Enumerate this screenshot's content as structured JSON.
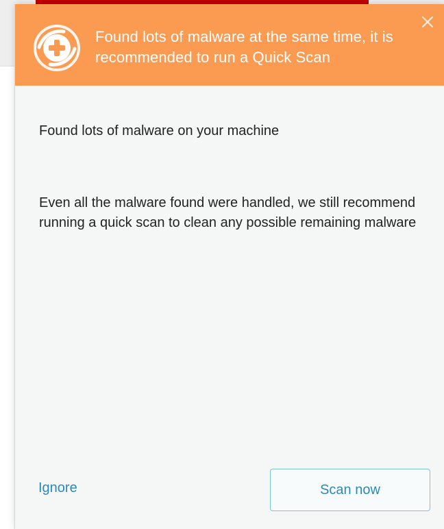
{
  "notification": {
    "title": "Found lots of malware at the same time, it is recommended to run a Quick Scan",
    "heading": "Found lots of malware on your machine",
    "body": "Even all the malware found were handled, we still recommend running a quick scan to clean any possible remaining malware",
    "actions": {
      "ignore_label": "Ignore",
      "scan_label": "Scan now"
    }
  },
  "colors": {
    "header_background": "#fb9b52",
    "link_blue": "#2a89b8",
    "button_border": "#7bc3dd",
    "background_red": "#c30000"
  },
  "icons": {
    "header": "shield-plus-icon",
    "close": "close-icon"
  }
}
